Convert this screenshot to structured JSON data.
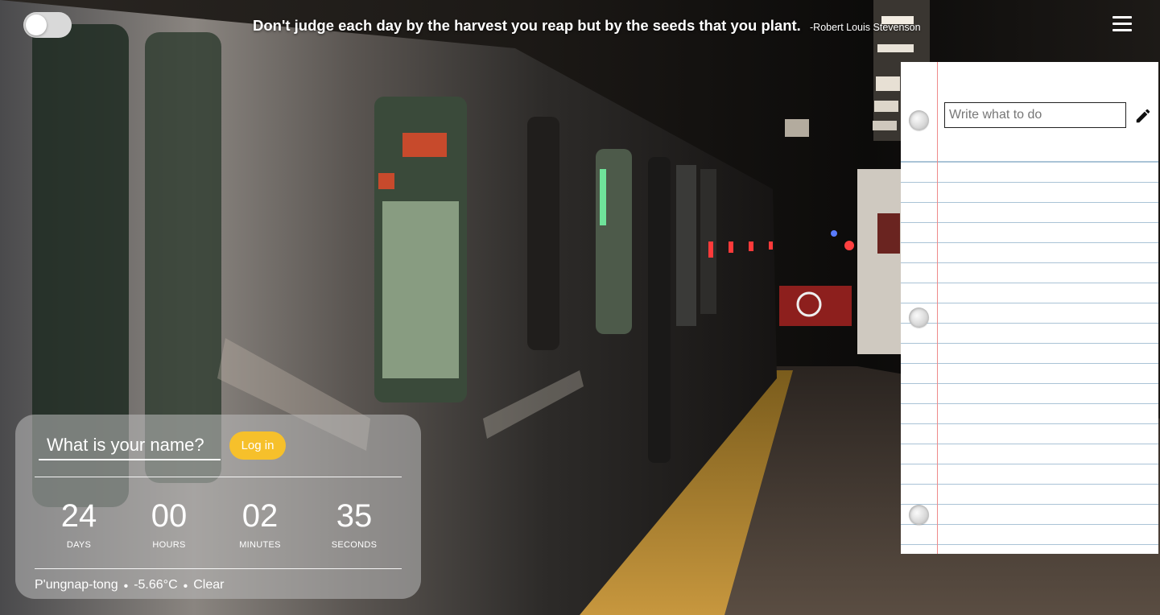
{
  "theme_toggle": {
    "state": "off"
  },
  "quote": {
    "text": "Don't judge each day by the harvest you reap but by the seeds that you plant.",
    "author": "-Robert Louis Stevenson"
  },
  "menu": {
    "icon": "hamburger-menu-icon"
  },
  "todo": {
    "input_placeholder": "Write what to do",
    "input_value": "",
    "submit_icon": "pencil-icon"
  },
  "login": {
    "name_placeholder": "What is your name?",
    "button_label": "Log in"
  },
  "countdown": {
    "days": {
      "value": "24",
      "label": "DAYS"
    },
    "hours": {
      "value": "00",
      "label": "HOURS"
    },
    "minutes": {
      "value": "02",
      "label": "MINUTES"
    },
    "seconds": {
      "value": "35",
      "label": "SECONDS"
    }
  },
  "weather": {
    "location": "P'ungnap-tong",
    "temperature": "-5.66°C",
    "condition": "Clear",
    "separator": "•"
  },
  "colors": {
    "login_button": "#f6c02b",
    "card_background": "rgba(190,190,190,0.55)",
    "notebook_margin_line": "#ef8a8a",
    "notebook_rule_line": "#aac3d6"
  }
}
